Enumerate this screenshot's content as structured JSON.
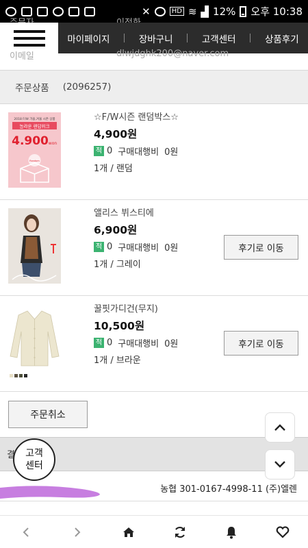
{
  "status_bar": {
    "battery": "12%",
    "time": "오후 10:38"
  },
  "nav": {
    "items": [
      "마이페이지",
      "장바구니",
      "고객센터",
      "상품후기"
    ]
  },
  "order_info": {
    "orderer_label": "주문자",
    "orderer_value": "이정화",
    "email_label": "이메일",
    "email_value": "dlwjdghk200@naver.com"
  },
  "section": {
    "title": "주문상품",
    "order_no": "(2096257)"
  },
  "products": [
    {
      "name": "☆F/W시즌 랜덤박스☆",
      "price": "4,900원",
      "badge": "적",
      "mileage": "0",
      "fee_label": "구매대행비",
      "fee": "0원",
      "option": "1개 / 랜덤",
      "thumb_text_top": "2018 F/W 가을,겨울 시즌 상품",
      "thumb_text_mid": "놀라운 랜덤위크",
      "thumb_price": "4.900",
      "thumb_won": "won",
      "thumb_box_label": "Random"
    },
    {
      "name": "앨리스 뷔스티에",
      "price": "6,900원",
      "badge": "적",
      "mileage": "0",
      "fee_label": "구매대행비",
      "fee": "0원",
      "option": "1개 / 그레이",
      "review_label": "후기로 이동"
    },
    {
      "name": "꿀핏가디건(무지)",
      "price": "10,500원",
      "badge": "적",
      "mileage": "0",
      "fee_label": "구매대행비",
      "fee": "0원",
      "option": "1개 / 브라운",
      "review_label": "후기로 이동"
    }
  ],
  "cancel_label": "주문취소",
  "payment": {
    "label": "결제",
    "cs_line1": "고객",
    "cs_line2": "센터",
    "account": "농협 301-0167-4998-11 (주)엘렌"
  },
  "colors": {
    "nav_bg": "#2c2c2c",
    "badge": "#3cb371",
    "scribble": "#c77ee0"
  }
}
